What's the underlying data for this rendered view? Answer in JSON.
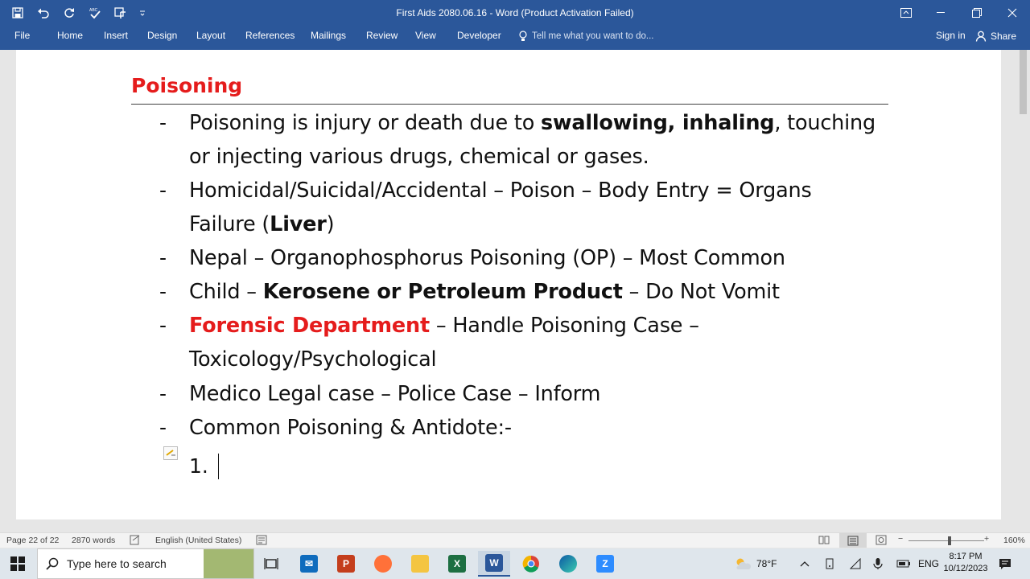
{
  "window": {
    "title": "First Aids 2080.06.16  -  Word (Product Activation Failed)"
  },
  "ribbon": {
    "tabs": [
      "File",
      "Home",
      "Insert",
      "Design",
      "Layout",
      "References",
      "Mailings",
      "Review",
      "View",
      "Developer"
    ],
    "tell_me": "Tell me what you want to do...",
    "sign_in": "Sign in",
    "share": "Share"
  },
  "document": {
    "heading": "Poisoning",
    "bullet_marker": "-",
    "items": {
      "l1_a": "Poisoning is injury or death due to ",
      "l1_b": "swallowing, inhaling",
      "l1_c": ", touching",
      "l1_d": "or injecting various drugs, chemical or gases.",
      "l2_a": "Homicidal/Suicidal/Accidental – Poison – Body Entry = Organs",
      "l2_b": "Failure (",
      "l2_c": "Liver",
      "l2_d": ")",
      "l3": "Nepal – Organophosphorus Poisoning (OP) – Most Common",
      "l4_a": "Child – ",
      "l4_b": "Kerosene or Petroleum Product",
      "l4_c": " – Do Not Vomit",
      "l5_a": "Forensic Department",
      "l5_b": " – Handle Poisoning Case –",
      "l5_c": "Toxicology/Psychological",
      "l6": "Medico Legal case – Police Case – Inform",
      "l7": "Common Poisoning & Antidote:-"
    },
    "list_number": "1."
  },
  "status_bar": {
    "page": "Page 22 of 22",
    "words": "2870 words",
    "language": "English (United States)",
    "zoom": "160%"
  },
  "taskbar": {
    "search_placeholder": "Type here to search",
    "weather": "78°F",
    "language": "ENG",
    "time": "8:17 PM",
    "date": "10/12/2023"
  },
  "colors": {
    "word_blue": "#2b579a",
    "heading_red": "#e51c1c"
  }
}
